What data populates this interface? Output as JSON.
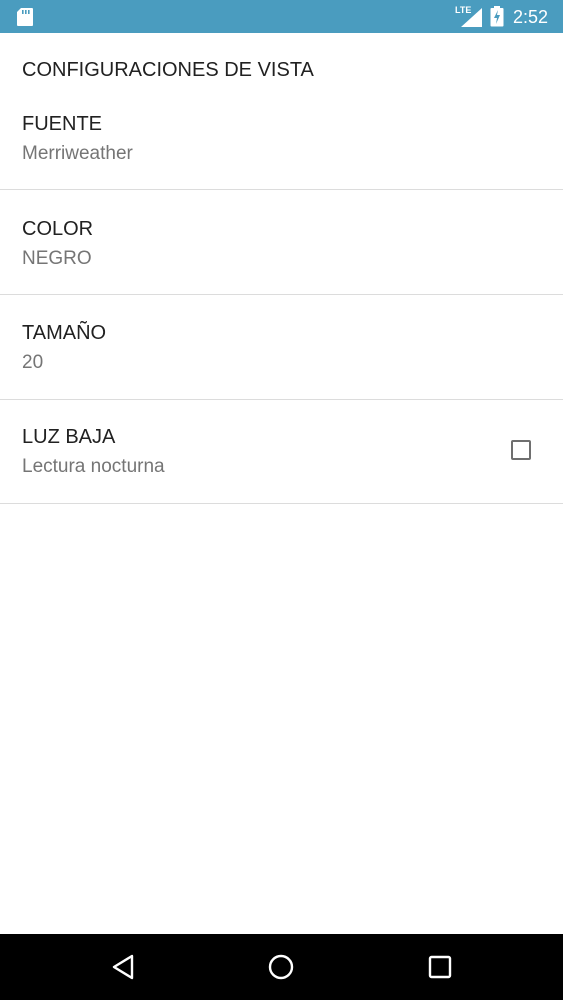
{
  "status_bar": {
    "time": "2:52",
    "network": "LTE",
    "background_color": "#4a9cbf",
    "icons": [
      "sd-card-icon",
      "lte-signal-icon",
      "battery-charging-icon"
    ]
  },
  "settings": {
    "section_title": "CONFIGURACIONES DE VISTA",
    "items": [
      {
        "title": "FUENTE",
        "summary": "Merriweather"
      },
      {
        "title": "COLOR",
        "summary": "NEGRO"
      },
      {
        "title": "TAMAÑO",
        "summary": "20"
      },
      {
        "title": "LUZ BAJA",
        "summary": "Lectura nocturna",
        "checked": false
      }
    ]
  },
  "nav_bar": {
    "buttons": [
      "back-icon",
      "home-icon",
      "recents-icon"
    ]
  }
}
